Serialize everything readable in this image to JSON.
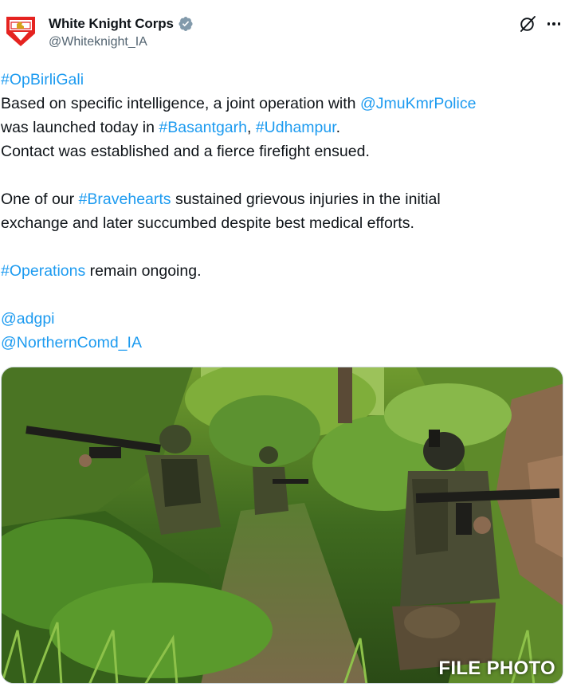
{
  "account": {
    "display_name": "White Knight Corps",
    "handle": "@Whiteknight_IA",
    "verified": true,
    "avatar_icon": "white-knight-corps-emblem-icon"
  },
  "actions": {
    "grok_icon": "grok-icon",
    "more_icon": "more-options-icon"
  },
  "tweet": {
    "line1_tag": "#OpBirliGali",
    "line2_text": "Based on specific intelligence, a joint operation with ",
    "line2_mention": "@JmuKmrPolice",
    "line3_text": "was launched today in ",
    "line3_tag1": "#Basantgarh",
    "line3_sep": ", ",
    "line3_tag2": "#Udhampur",
    "line3_end": ".",
    "line4_text": "Contact was established and a fierce firefight ensued.",
    "line6_text_a": "One of our ",
    "line6_tag": "#Bravehearts",
    "line6_text_b": " sustained grievous injuries in the initial",
    "line7_text": "exchange and later succumbed despite best medical efforts.",
    "line9_tag": "#Operations",
    "line9_text": " remain ongoing.",
    "line11_mention": "@adgpi",
    "line12_mention": "@NorthernComd_IA"
  },
  "media": {
    "overlay_label": "FILE PHOTO",
    "description_icon": "soldiers-in-jungle-photo"
  },
  "colors": {
    "link": "#1d9bf0",
    "text": "#0f1419",
    "secondary": "#536471",
    "verified_badge": "#829aab"
  }
}
